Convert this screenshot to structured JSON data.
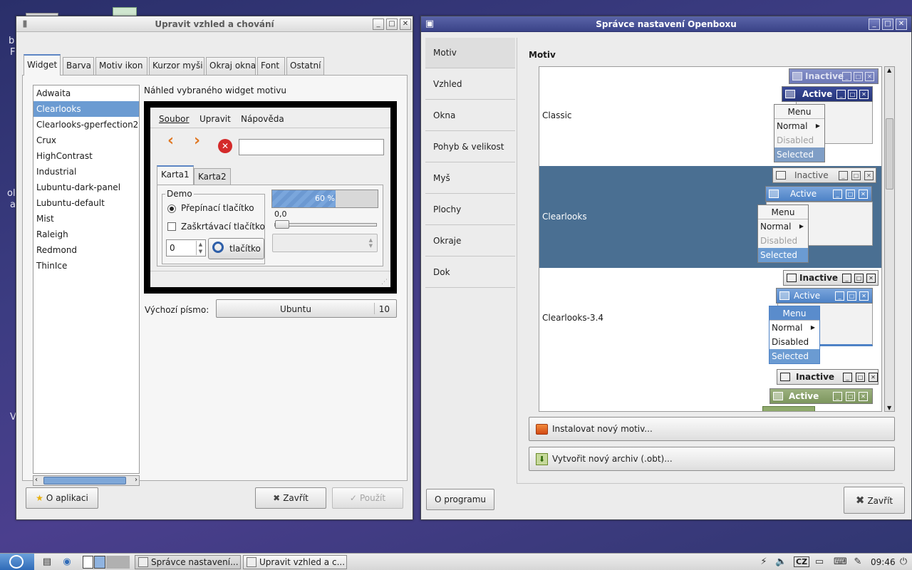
{
  "appearance_window": {
    "title": "Upravit vzhled a chování",
    "tabs": [
      "Widget",
      "Barva",
      "Motiv ikon",
      "Kurzor myši",
      "Okraj okna",
      "Font",
      "Ostatní"
    ],
    "theme_list": [
      "Adwaita",
      "Clearlooks",
      "Clearlooks-gperfection2",
      "Crux",
      "HighContrast",
      "Industrial",
      "Lubuntu-dark-panel",
      "Lubuntu-default",
      "Mist",
      "Raleigh",
      "Redmond",
      "ThinIce"
    ],
    "selected_theme": "Clearlooks",
    "preview_label": "Náhled vybraného widget motivu",
    "preview": {
      "menu": [
        "Soubor",
        "Upravit",
        "Nápověda"
      ],
      "tabs": [
        "Karta1",
        "Karta2"
      ],
      "frame_label": "Demo",
      "radio_label": "Přepínací tlačítko",
      "checkbox_label": "Zaškrtávací tlačítko",
      "spin_value": "0",
      "button_label": "tlačítko",
      "progress_text": "60 %",
      "progress_fraction": 0.6,
      "scale_value": "0,0"
    },
    "default_font_label": "Výchozí písmo:",
    "default_font_name": "Ubuntu",
    "default_font_size": "10",
    "about_button": "O aplikaci",
    "close_button": "Zavřít",
    "apply_button": "Použít"
  },
  "openbox_window": {
    "title": "Správce nastavení Openboxu",
    "sidebar": [
      "Motiv",
      "Vzhled",
      "Okna",
      "Pohyb & velikost",
      "Myš",
      "Plochy",
      "Okraje",
      "Dok"
    ],
    "selected_section": "Motiv",
    "section_heading": "Motiv",
    "themes": [
      {
        "name": "Classic",
        "inactive": "Inactive",
        "active": "Active",
        "menu": [
          "Menu",
          "Normal",
          "Disabled",
          "Selected"
        ]
      },
      {
        "name": "Clearlooks",
        "inactive": "Inactive",
        "active": "Active",
        "menu": [
          "Menu",
          "Normal",
          "Disabled",
          "Selected"
        ]
      },
      {
        "name": "Clearlooks-3.4",
        "inactive": "Inactive",
        "active": "Active",
        "menu": [
          "Menu",
          "Normal",
          "Disabled",
          "Selected"
        ]
      },
      {
        "name": "",
        "inactive": "Inactive",
        "active": "Active"
      }
    ],
    "selected_theme": "Clearlooks",
    "install_button": "Instalovat nový motiv...",
    "archive_button": "Vytvořit nový archiv (.obt)...",
    "about_button": "O programu",
    "close_button": "Zavřít"
  },
  "taskbar": {
    "tasks": [
      "Správce nastavení...",
      "Upravit vzhled a c..."
    ],
    "layout_indicator": "CZ",
    "clock": "09:46"
  },
  "desktop": {
    "fragments": [
      "b",
      "F",
      "ol",
      "a",
      "V"
    ]
  }
}
